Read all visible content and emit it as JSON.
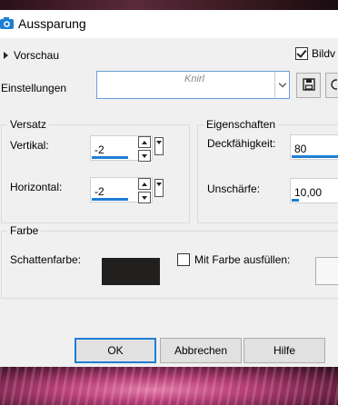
{
  "window": {
    "title": "Aussparung"
  },
  "preview": {
    "label": "Vorschau",
    "bild_label": "Bildv",
    "bild_checked": true
  },
  "settings": {
    "label": "Einstellungen",
    "preset_value": "Knirl"
  },
  "versatz": {
    "title": "Versatz",
    "vertical_label": "Vertikal:",
    "vertical_value": "-2",
    "horizontal_label": "Horizontal:",
    "horizontal_value": "-2"
  },
  "eigenschaften": {
    "title": "Eigenschaften",
    "opacity_label": "Deckfähigkeit:",
    "opacity_value": "80",
    "blur_label": "Unschärfe:",
    "blur_value": "10,00"
  },
  "farbe": {
    "title": "Farbe",
    "shadow_label": "Schattenfarbe:",
    "shadow_color": "#22201f",
    "fill_label": "Mit Farbe ausfüllen:",
    "fill_checked": false
  },
  "buttons": {
    "ok": "OK",
    "cancel": "Abbrechen",
    "help": "Hilfe"
  },
  "icons": {
    "app": "camera-icon",
    "save": "save-icon",
    "dropdown": "chevron-down-icon"
  },
  "colors": {
    "accent": "#1e7ed4",
    "dialog_bg": "#f0f0f0"
  }
}
